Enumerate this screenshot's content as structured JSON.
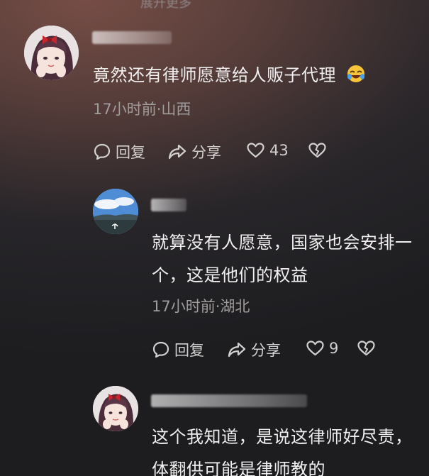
{
  "top_cut_text": "展开更多",
  "comments": [
    {
      "username": "",
      "text_lines": [
        "竟然还有律师愿意给人贩子代理"
      ],
      "emoji": "rolling-on-floor-laughing",
      "time_location": "17小时前·山西",
      "actions": {
        "reply": "回复",
        "share": "分享",
        "likes": "43"
      }
    },
    {
      "username": "",
      "text_lines": [
        "就算没有人愿意，国家也会安排一",
        "个，这是他们的权益"
      ],
      "time_location": "17小时前·湖北",
      "actions": {
        "reply": "回复",
        "share": "分享",
        "likes": "9"
      }
    },
    {
      "username": "",
      "text_lines": [
        "这个我知道，是说这律师好尽责，",
        "体翻供可能是律师教的"
      ]
    }
  ],
  "colors": {
    "accent_text": "#f0eeee",
    "meta_text": "#a09c9c"
  }
}
